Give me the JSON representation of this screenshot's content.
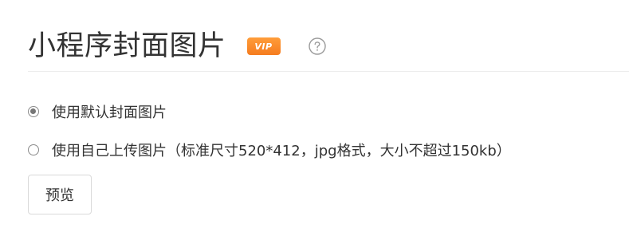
{
  "header": {
    "title": "小程序封面图片",
    "badge": "VIP",
    "help_icon": "question-circle-icon"
  },
  "cover_options": {
    "items": [
      {
        "label": "使用默认封面图片",
        "checked": true
      },
      {
        "label": "使用自己上传图片（标准尺寸520*412，jpg格式，大小不超过150kb）",
        "checked": false
      }
    ]
  },
  "actions": {
    "preview_label": "预览"
  },
  "colors": {
    "badge_bg": "#f5862a",
    "text": "#333333",
    "divider": "#ececec"
  }
}
